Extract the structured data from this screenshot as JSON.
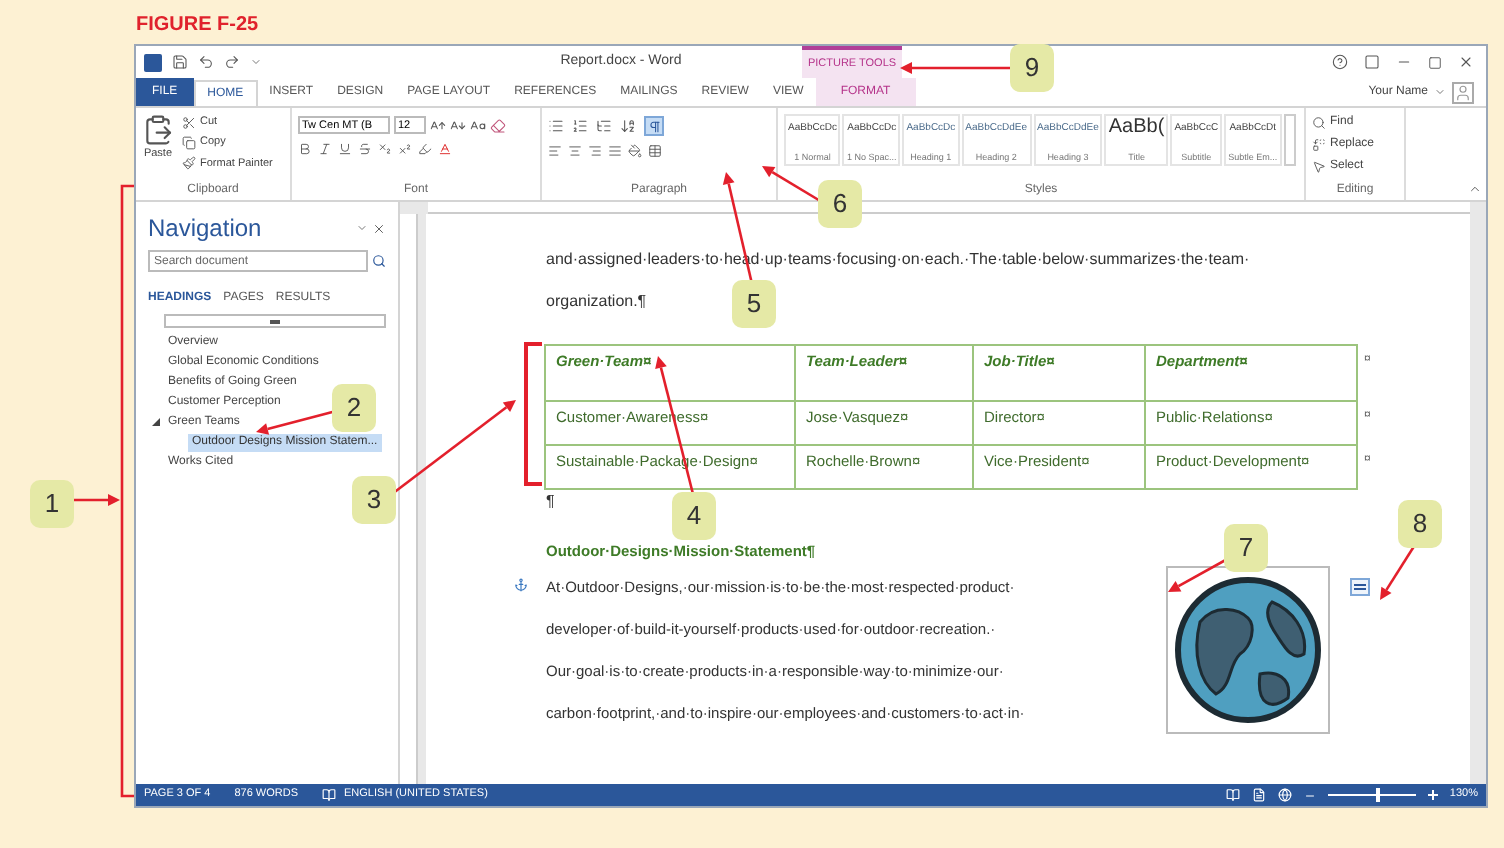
{
  "figure_label": "FIGURE F-25",
  "window": {
    "title": "Report.docx - Word",
    "contextual_group": "PICTURE TOOLS",
    "user": "Your Name"
  },
  "tabs": [
    {
      "label": "FILE",
      "kind": "file",
      "selected": false
    },
    {
      "label": "HOME",
      "kind": "normal",
      "selected": true
    },
    {
      "label": "INSERT",
      "kind": "normal",
      "selected": false
    },
    {
      "label": "DESIGN",
      "kind": "normal",
      "selected": false
    },
    {
      "label": "PAGE LAYOUT",
      "kind": "normal",
      "selected": false
    },
    {
      "label": "REFERENCES",
      "kind": "normal",
      "selected": false
    },
    {
      "label": "MAILINGS",
      "kind": "normal",
      "selected": false
    },
    {
      "label": "REVIEW",
      "kind": "normal",
      "selected": false
    },
    {
      "label": "VIEW",
      "kind": "normal",
      "selected": false
    },
    {
      "label": "FORMAT",
      "kind": "contextual",
      "selected": false
    }
  ],
  "ribbon": {
    "clipboard": {
      "label": "Clipboard",
      "paste": "Paste",
      "cut": "Cut",
      "copy": "Copy",
      "format_painter": "Format Painter"
    },
    "font": {
      "label": "Font",
      "name": "Tw Cen MT (B",
      "size": "12"
    },
    "paragraph": {
      "label": "Paragraph",
      "show_marks": {
        "selected": true
      }
    },
    "styles": {
      "label": "Styles",
      "items": [
        {
          "sample": "AaBbCcDc",
          "name": "1 Normal",
          "kind": "plain"
        },
        {
          "sample": "AaBbCcDc",
          "name": "1 No Spac...",
          "kind": "plain"
        },
        {
          "sample": "AaBbCcDc",
          "name": "Heading 1",
          "kind": "heading"
        },
        {
          "sample": "AaBbCcDdEe",
          "name": "Heading 2",
          "kind": "heading"
        },
        {
          "sample": "AaBbCcDdEe",
          "name": "Heading 3",
          "kind": "heading"
        },
        {
          "sample": "AaBb(",
          "name": "Title",
          "kind": "title"
        },
        {
          "sample": "AaBbCcC",
          "name": "Subtitle",
          "kind": "plain"
        },
        {
          "sample": "AaBbCcDt",
          "name": "Subtle Em...",
          "kind": "plain"
        }
      ]
    },
    "editing": {
      "label": "Editing",
      "find": "Find",
      "replace": "Replace",
      "select": "Select"
    }
  },
  "navigation": {
    "title": "Navigation",
    "search": {
      "placeholder": "Search document"
    },
    "tabs": [
      {
        "label": "HEADINGS",
        "selected": true
      },
      {
        "label": "PAGES",
        "selected": false
      },
      {
        "label": "RESULTS",
        "selected": false
      }
    ],
    "headings": [
      {
        "label": "Overview",
        "selected": false
      },
      {
        "label": "Global Economic Conditions",
        "selected": false
      },
      {
        "label": "Benefits of Going Green",
        "selected": false
      },
      {
        "label": "Customer Perception",
        "selected": false
      },
      {
        "label": "Green Teams",
        "selected": false,
        "expanded": true,
        "children": [
          {
            "label": "Outdoor Designs Mission Statem...",
            "selected": true
          }
        ]
      },
      {
        "label": "Works Cited",
        "selected": false
      }
    ]
  },
  "document": {
    "intro_lines": [
      "and·assigned·leaders·to·head·up·teams·focusing·on·each.·The·table·below·summarizes·the·team·",
      "organization.¶"
    ],
    "table": {
      "header": {
        "cells": [
          "Green·Team¤",
          "Team·Leader¤",
          "Job·Title¤",
          "Department¤"
        ],
        "end": "¤"
      },
      "rows": [
        {
          "cells": [
            "Customer·Awareness¤",
            "Jose·Vasquez¤",
            "Director¤",
            "Public·Relations¤"
          ],
          "end": "¤"
        },
        {
          "cells": [
            "Sustainable·Package·Design¤",
            "Rochelle·Brown¤",
            "Vice·President¤",
            "Product·Development¤"
          ],
          "end": "¤"
        }
      ]
    },
    "after_table": "¶",
    "heading": "Outdoor·Designs·Mission·Statement¶",
    "paragraph_lines": [
      "At·Outdoor·Designs,·our·mission·is·to·be·the·most·respected·product·",
      "developer·of·build-it-yourself·products·used·for·outdoor·recreation.·",
      "Our·goal·is·to·create·products·in·a·responsible·way·to·minimize·our·",
      "carbon·footprint,·and·to·inspire·our·employees·and·customers·to·act·in·"
    ]
  },
  "status_bar": {
    "page": "PAGE 3 OF 4",
    "words": "876 WORDS",
    "language": "ENGLISH (UNITED STATES)",
    "zoom": "130%",
    "zoom_slider": {
      "level": 0.55
    }
  },
  "callouts": [
    "1",
    "2",
    "3",
    "4",
    "5",
    "6",
    "7",
    "8",
    "9"
  ]
}
